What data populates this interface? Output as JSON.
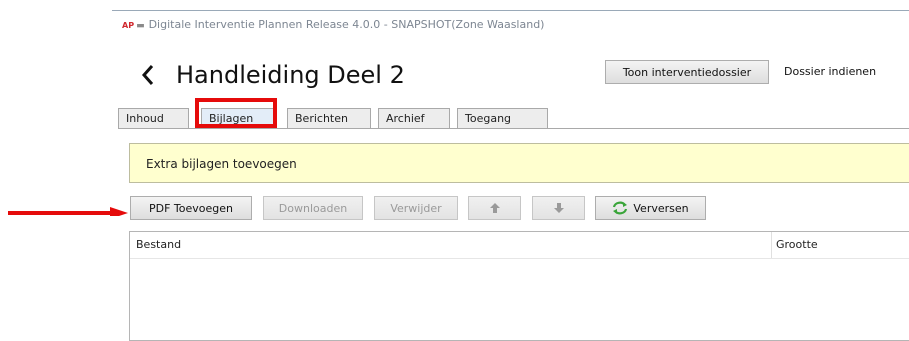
{
  "window": {
    "title": "Digitale Interventie Plannen Release 4.0.0 - SNAPSHOT(Zone Waasland)",
    "logo_text": "AP"
  },
  "header": {
    "back_icon": "chevron-left-icon",
    "page_title": "Handleiding Deel 2",
    "show_dossier_label": "Toon interventiedossier",
    "submit_dossier_label": "Dossier indienen"
  },
  "tabs": [
    {
      "label": "Inhoud",
      "active": false
    },
    {
      "label": "Bijlagen",
      "active": true
    },
    {
      "label": "Berichten",
      "active": false
    },
    {
      "label": "Archief",
      "active": false
    },
    {
      "label": "Toegang",
      "active": false
    }
  ],
  "notice": {
    "text": "Extra bijlagen toevoegen"
  },
  "toolbar": {
    "add_pdf_label": "PDF Toevoegen",
    "download_label": "Downloaden",
    "delete_label": "Verwijder",
    "move_up_icon": "arrow-up-icon",
    "move_down_icon": "arrow-down-icon",
    "refresh_label": "Verversen",
    "refresh_icon": "refresh-icon"
  },
  "table": {
    "columns": [
      "Bestand",
      "Grootte"
    ],
    "rows": []
  },
  "colors": {
    "annotation_red": "#e50b0b",
    "notice_bg": "#ffffcf",
    "active_tab_bg": "#e3edf8",
    "refresh_green": "#3aa53a"
  }
}
